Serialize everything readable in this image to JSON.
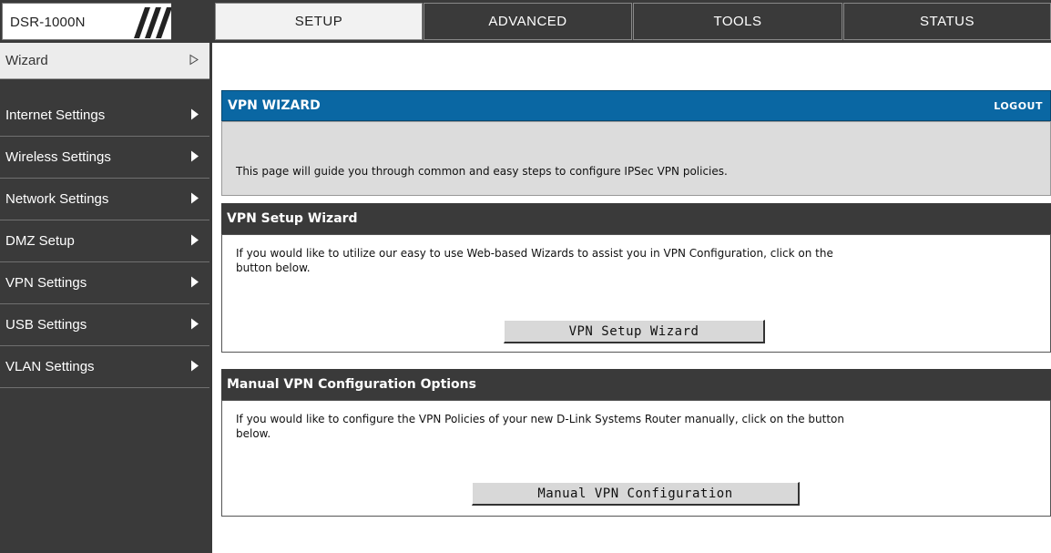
{
  "header": {
    "model": "DSR-1000N",
    "tabs": [
      {
        "label": "SETUP"
      },
      {
        "label": "ADVANCED"
      },
      {
        "label": "TOOLS"
      },
      {
        "label": "STATUS"
      }
    ]
  },
  "sidebar": {
    "items": [
      {
        "label": "Wizard",
        "icon": "chevron-right-outline-icon"
      },
      {
        "label": "Internet Settings",
        "icon": "play-arrow-icon"
      },
      {
        "label": "Wireless Settings",
        "icon": "play-arrow-icon"
      },
      {
        "label": "Network Settings",
        "icon": "play-arrow-icon"
      },
      {
        "label": "DMZ Setup",
        "icon": "play-arrow-icon"
      },
      {
        "label": "VPN Settings",
        "icon": "play-arrow-icon"
      },
      {
        "label": "USB Settings",
        "icon": "play-arrow-icon"
      },
      {
        "label": "VLAN Settings",
        "icon": "play-arrow-icon"
      }
    ]
  },
  "wizard_panel": {
    "title": "VPN WIZARD",
    "logout": "LOGOUT",
    "description": "This page will guide you through common and easy steps to configure IPSec VPN policies."
  },
  "setup_panel": {
    "title": "VPN Setup Wizard",
    "line1": "If you would like to utilize our easy to use Web-based Wizards to assist you in VPN Configuration, click on the",
    "line2": "button below.",
    "button": "VPN Setup Wizard"
  },
  "manual_panel": {
    "title": "Manual VPN Configuration Options",
    "line1": "If you would like to configure the VPN Policies of your new D-Link Systems Router manually, click on the button",
    "line2": "below.",
    "button": "Manual VPN Configuration"
  },
  "colors": {
    "dark_bar": "#3a3a3a",
    "wizard_blue": "#0a67a3",
    "info_bg": "#dcdcdc"
  }
}
